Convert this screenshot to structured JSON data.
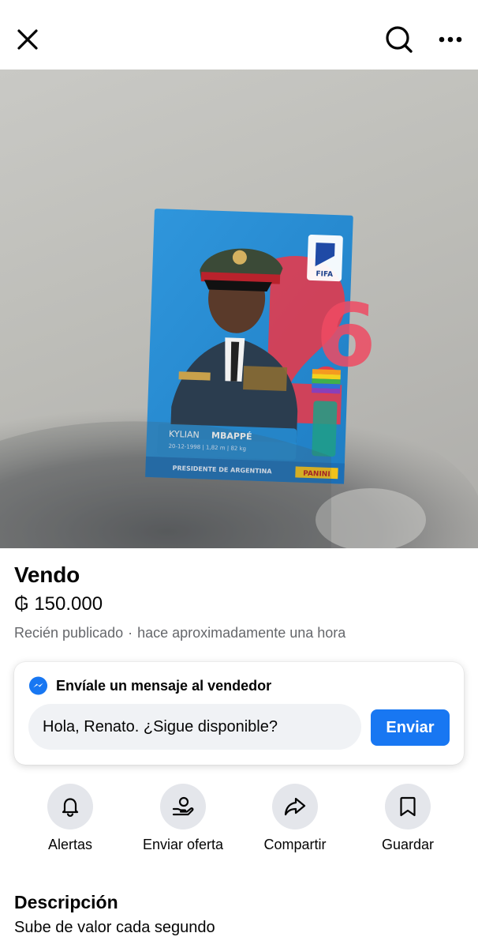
{
  "topbar": {
    "close_icon": "close-icon",
    "search_icon": "search-icon",
    "more_icon": "more-horizontal-icon"
  },
  "photo": {
    "card": {
      "player_name_first": "KYLIAN",
      "player_name_last": "MBAPPÉ",
      "player_stats": "20-12-1998 | 1,82 m | 82 kg",
      "caption": "PRESIDENTE DE ARGENTINA",
      "brand": "PANINI",
      "badge": "FIFA",
      "card_color": "#2f8fd6"
    }
  },
  "listing": {
    "title": "Vendo",
    "price": "₲ 150.000",
    "published": "Recién publicado",
    "time_ago": "hace aproximadamente una hora"
  },
  "message": {
    "header": "Envíale un mensaje al vendedor",
    "input_value": "Hola, Renato. ¿Sigue disponible?",
    "send_label": "Enviar",
    "accent": "#1877f2"
  },
  "actions": [
    {
      "label": "Alertas",
      "icon": "bell-icon"
    },
    {
      "label": "Enviar oferta",
      "icon": "offer-hand-icon"
    },
    {
      "label": "Compartir",
      "icon": "share-arrow-icon"
    },
    {
      "label": "Guardar",
      "icon": "bookmark-icon"
    }
  ],
  "description": {
    "heading": "Descripción",
    "text": "Sube de valor cada segundo"
  }
}
